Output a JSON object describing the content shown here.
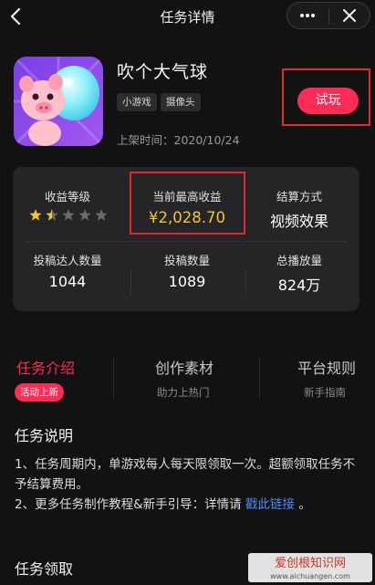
{
  "header": {
    "title": "任务详情",
    "back_icon": "chevron-left-icon",
    "more_icon": "more-dots-icon",
    "close_icon": "close-icon"
  },
  "app": {
    "name": "吹个大气球",
    "tags": [
      "小游戏",
      "摄像头"
    ],
    "launch_label": "上架时间：2020/10/24",
    "try_label": "试玩",
    "icon": "pig-balloon-game-icon"
  },
  "stats": {
    "income_level_label": "收益等级",
    "income_level_rating": 1.5,
    "income_level_max": 5,
    "max_income_label": "当前最高收益",
    "max_income_value": "¥2,028.70",
    "settle_label": "结算方式",
    "settle_value": "视频效果",
    "creators_label": "投稿达人数量",
    "creators_value": "1044",
    "posts_label": "投稿数量",
    "posts_value": "1089",
    "plays_label": "总播放量",
    "plays_value": "824万"
  },
  "tabs": [
    {
      "label": "任务介绍",
      "sub": "活动上新"
    },
    {
      "label": "创作素材",
      "sub": "助力上热门"
    },
    {
      "label": "平台规则",
      "sub": "新手指南"
    }
  ],
  "description": {
    "title": "任务说明",
    "line1": "1、任务周期内，单游戏每人每天限领取一次。超额领取任务不予结算费用。",
    "line2_prefix": "2、更多任务制作教程&新手引导：详情请 ",
    "line2_link": "戳此链接",
    "line2_suffix": " 。"
  },
  "claim": {
    "title": "任务领取"
  },
  "watermark": {
    "text": "爱创根知识网",
    "url": "www.aichuangen.com"
  },
  "colors": {
    "accent": "#fe2c55",
    "price": "#f5c531",
    "link": "#4f8cf7",
    "highlight_border": "#e02a2f"
  }
}
